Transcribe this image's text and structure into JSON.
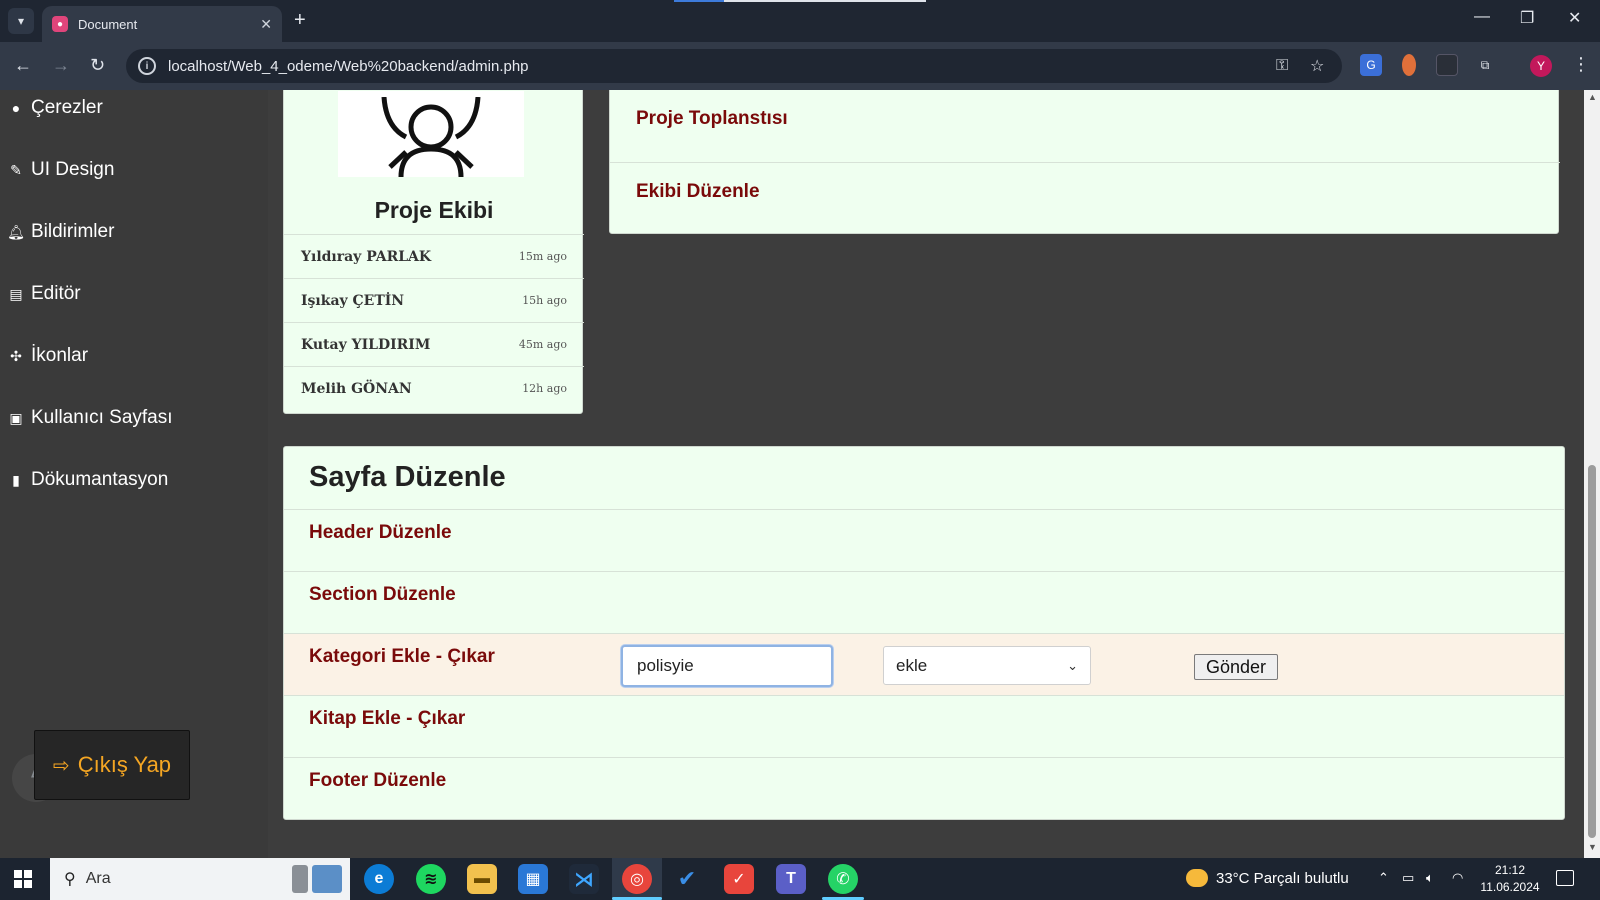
{
  "browser": {
    "tab_title": "Document",
    "url": "localhost/Web_4_odeme/Web%20backend/admin.php",
    "profile_initial": "Y"
  },
  "sidebar": {
    "items": [
      {
        "label": "Çerezler",
        "icon": "cookie-icon"
      },
      {
        "label": "UI Design",
        "icon": "brush-icon"
      },
      {
        "label": "Bildirimler",
        "icon": "bell-icon"
      },
      {
        "label": "Editör",
        "icon": "editor-icon"
      },
      {
        "label": "İkonlar",
        "icon": "icons-icon"
      },
      {
        "label": "Kullanıcı Sayfası",
        "icon": "user-card-icon"
      },
      {
        "label": "Dökumantasyon",
        "icon": "book-icon"
      }
    ],
    "logout_label": "Çıkış Yap"
  },
  "team": {
    "title": "Proje Ekibi",
    "members": [
      {
        "name": "Yıldıray PARLAK",
        "time": "15m ago"
      },
      {
        "name": "Işıkay ÇETİN",
        "time": "15h ago"
      },
      {
        "name": "Kutay YILDIRIM",
        "time": "45m ago"
      },
      {
        "name": "Melih GÖNAN",
        "time": "12h ago"
      }
    ]
  },
  "top_card": {
    "items": [
      "Proje Toplanstısı",
      "Ekibi Düzenle"
    ]
  },
  "page_edit": {
    "title": "Sayfa Düzenle",
    "rows": [
      "Header Düzenle",
      "Section Düzenle",
      "Kategori Ekle - Çıkar",
      "Kitap Ekle - Çıkar",
      "Footer Düzenle"
    ],
    "category_input_value": "polisyie",
    "action_select_value": "ekle",
    "submit_label": "Gönder"
  },
  "taskbar": {
    "search_placeholder": "Ara",
    "weather": "33°C  Parçalı bulutlu",
    "time": "21:12",
    "date": "11.06.2024"
  },
  "colors": {
    "accent_text": "#7a0a0a",
    "card_bg": "#effff0",
    "logout_text": "#f5a623",
    "sidebar_bg": "#3a3a3a"
  }
}
